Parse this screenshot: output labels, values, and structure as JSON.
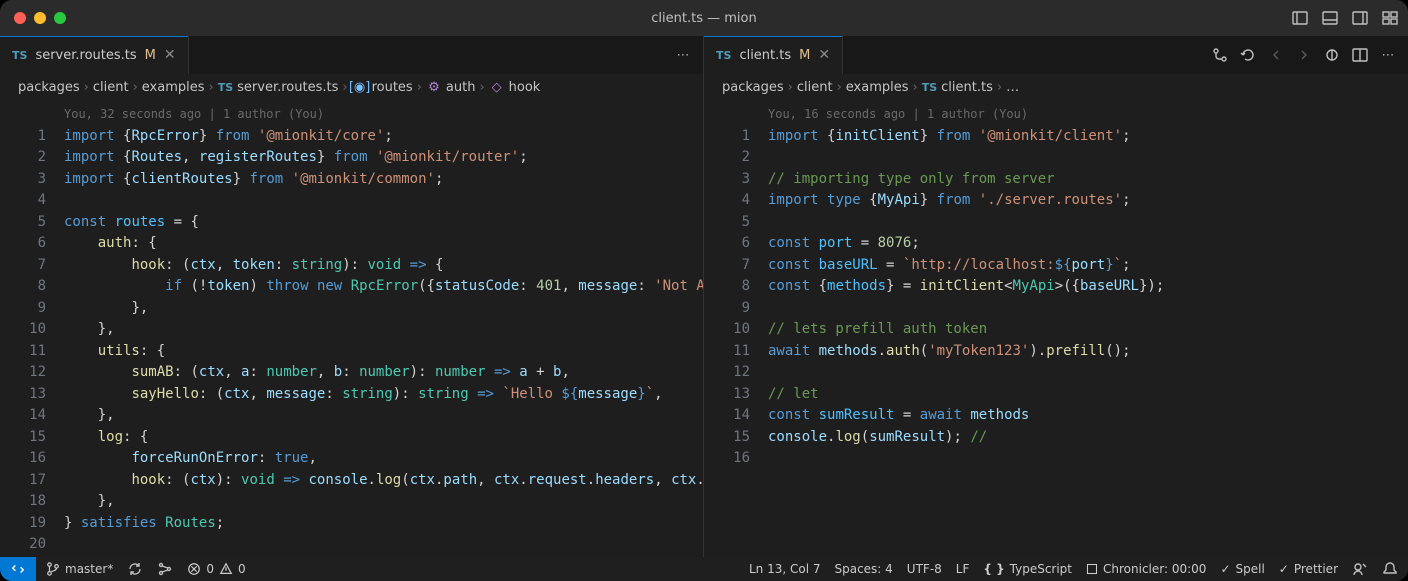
{
  "window_title": "client.ts — mion",
  "panes": [
    {
      "tab": {
        "lang": "TS",
        "filename": "server.routes.ts",
        "modified": "M"
      },
      "breadcrumbs": [
        {
          "text": "packages"
        },
        {
          "text": "client"
        },
        {
          "text": "examples"
        },
        {
          "lang": "TS",
          "text": "server.routes.ts"
        },
        {
          "sym": "var",
          "text": "routes"
        },
        {
          "sym": "method",
          "text": "auth"
        },
        {
          "sym": "method",
          "text": "hook"
        }
      ],
      "author_hint": "You, 32 seconds ago | 1 author (You)",
      "lines": [
        1,
        2,
        3,
        4,
        5,
        6,
        7,
        8,
        9,
        10,
        11,
        12,
        13,
        14,
        15,
        16,
        17,
        18,
        19,
        20
      ]
    },
    {
      "tab": {
        "lang": "TS",
        "filename": "client.ts",
        "modified": "M"
      },
      "breadcrumbs": [
        {
          "text": "packages"
        },
        {
          "text": "client"
        },
        {
          "text": "examples"
        },
        {
          "lang": "TS",
          "text": "client.ts"
        },
        {
          "text": "…"
        }
      ],
      "author_hint": "You, 16 seconds ago | 1 author (You)",
      "lines": [
        1,
        2,
        3,
        4,
        5,
        6,
        7,
        8,
        9,
        10,
        11,
        12,
        13,
        14,
        15,
        16
      ]
    }
  ],
  "code_left": [
    "<span class='kw'>import</span> <span class='pu'>{</span><span class='va'>RpcError</span><span class='pu'>}</span> <span class='kw'>from</span> <span class='str'>'@mionkit/core'</span><span class='pu'>;</span>",
    "<span class='kw'>import</span> <span class='pu'>{</span><span class='va'>Routes</span><span class='pu'>, </span><span class='va'>registerRoutes</span><span class='pu'>}</span> <span class='kw'>from</span> <span class='str'>'@mionkit/router'</span><span class='pu'>;</span>",
    "<span class='kw'>import</span> <span class='pu'>{</span><span class='va'>clientRoutes</span><span class='pu'>}</span> <span class='kw'>from</span> <span class='str'>'@mionkit/common'</span><span class='pu'>;</span>",
    "",
    "<span class='kw'>const</span> <span class='co'>routes</span> <span class='op'>=</span> <span class='pu'>{</span>",
    "    <span class='fn'>auth</span><span class='pu'>: {</span>",
    "        <span class='fn'>hook</span><span class='pu'>: (</span><span class='va'>ctx</span><span class='pu'>, </span><span class='va'>token</span><span class='pu'>: </span><span class='ty'>string</span><span class='pu'>): </span><span class='ty'>void</span> <span class='kw'>=&gt;</span> <span class='pu'>{</span>",
    "            <span class='kw'>if</span> <span class='pu'>(</span><span class='op'>!</span><span class='va'>token</span><span class='pu'>)</span> <span class='kw'>throw</span> <span class='kw'>new</span> <span class='ty'>RpcError</span><span class='pu'>({</span><span class='va'>statusCode</span><span class='pu'>: </span><span class='nu'>401</span><span class='pu'>, </span><span class='va'>message</span><span class='pu'>: </span><span class='str'>'Not A</span>",
    "        <span class='pu'>},</span>",
    "    <span class='pu'>},</span>",
    "    <span class='fn'>utils</span><span class='pu'>: {</span>",
    "        <span class='fn'>sumAB</span><span class='pu'>: (</span><span class='va'>ctx</span><span class='pu'>, </span><span class='va'>a</span><span class='pu'>: </span><span class='ty'>number</span><span class='pu'>, </span><span class='va'>b</span><span class='pu'>: </span><span class='ty'>number</span><span class='pu'>): </span><span class='ty'>number</span> <span class='kw'>=&gt;</span> <span class='va'>a</span> <span class='op'>+</span> <span class='va'>b</span><span class='pu'>,</span>",
    "        <span class='fn'>sayHello</span><span class='pu'>: (</span><span class='va'>ctx</span><span class='pu'>, </span><span class='va'>message</span><span class='pu'>: </span><span class='ty'>string</span><span class='pu'>): </span><span class='ty'>string</span> <span class='kw'>=&gt;</span> <span class='str'>`Hello </span><span class='kw'>${</span><span class='va'>message</span><span class='kw'>}</span><span class='str'>`</span><span class='pu'>,</span>",
    "    <span class='pu'>},</span>",
    "    <span class='fn'>log</span><span class='pu'>: {</span>",
    "        <span class='va'>forceRunOnError</span><span class='pu'>: </span><span class='kw'>true</span><span class='pu'>,</span>",
    "        <span class='fn'>hook</span><span class='pu'>: (</span><span class='va'>ctx</span><span class='pu'>): </span><span class='ty'>void</span> <span class='kw'>=&gt;</span> <span class='va'>console</span><span class='pu'>.</span><span class='fn'>log</span><span class='pu'>(</span><span class='va'>ctx</span><span class='pu'>.</span><span class='va'>path</span><span class='pu'>, </span><span class='va'>ctx</span><span class='pu'>.</span><span class='va'>request</span><span class='pu'>.</span><span class='va'>headers</span><span class='pu'>, </span><span class='va'>ctx</span><span class='pu'>.</span>",
    "    <span class='pu'>},</span>",
    "<span class='pu'>}</span> <span class='kw'>satisfies</span> <span class='ty'>Routes</span><span class='pu'>;</span>",
    ""
  ],
  "code_right": [
    "<span class='kw'>import</span> <span class='pu'>{</span><span class='va'>initClient</span><span class='pu'>}</span> <span class='kw'>from</span> <span class='str'>'@mionkit/client'</span><span class='pu'>;</span>",
    "",
    "<span class='cm'>// importing type only from server</span>",
    "<span class='kw'>import</span> <span class='kw'>type</span> <span class='pu'>{</span><span class='va'>MyApi</span><span class='pu'>}</span> <span class='kw'>from</span> <span class='str'>'./server.routes'</span><span class='pu'>;</span>",
    "",
    "<span class='kw'>const</span> <span class='co'>port</span> <span class='op'>=</span> <span class='nu'>8076</span><span class='pu'>;</span>",
    "<span class='kw'>const</span> <span class='co'>baseURL</span> <span class='op'>=</span> <span class='str'>`http://localhost:</span><span class='kw'>${</span><span class='va'>port</span><span class='kw'>}</span><span class='str'>`</span><span class='pu'>;</span>",
    "<span class='kw'>const</span> <span class='pu'>{</span><span class='co'>methods</span><span class='pu'>}</span> <span class='op'>=</span> <span class='fn'>initClient</span><span class='pu'>&lt;</span><span class='ty'>MyApi</span><span class='pu'>&gt;({</span><span class='va'>baseURL</span><span class='pu'>});</span>",
    "",
    "<span class='cm'>// lets prefill auth token</span>",
    "<span class='kw'>await</span> <span class='va'>methods</span><span class='pu'>.</span><span class='fn'>auth</span><span class='pu'>(</span><span class='str'>'myToken123'</span><span class='pu'>).</span><span class='fn'>prefill</span><span class='pu'>();</span>",
    "",
    "<span class='cm'>// let</span>",
    "<span class='kw'>const</span> <span class='co'>sumResult</span> <span class='op'>=</span> <span class='kw'>await</span> <span class='va'>methods</span>",
    "<span class='va'>console</span><span class='pu'>.</span><span class='fn'>log</span><span class='pu'>(</span><span class='va'>sumResult</span><span class='pu'>);</span> <span class='cm'>//</span>",
    ""
  ],
  "status": {
    "branch": "master*",
    "errors": "0",
    "warnings": "0",
    "cursor": "Ln 13, Col 7",
    "spaces": "Spaces: 4",
    "encoding": "UTF-8",
    "eol": "LF",
    "lang": "TypeScript",
    "chronicler": "Chronicler: 00:00",
    "spell": "Spell",
    "prettier": "Prettier"
  }
}
